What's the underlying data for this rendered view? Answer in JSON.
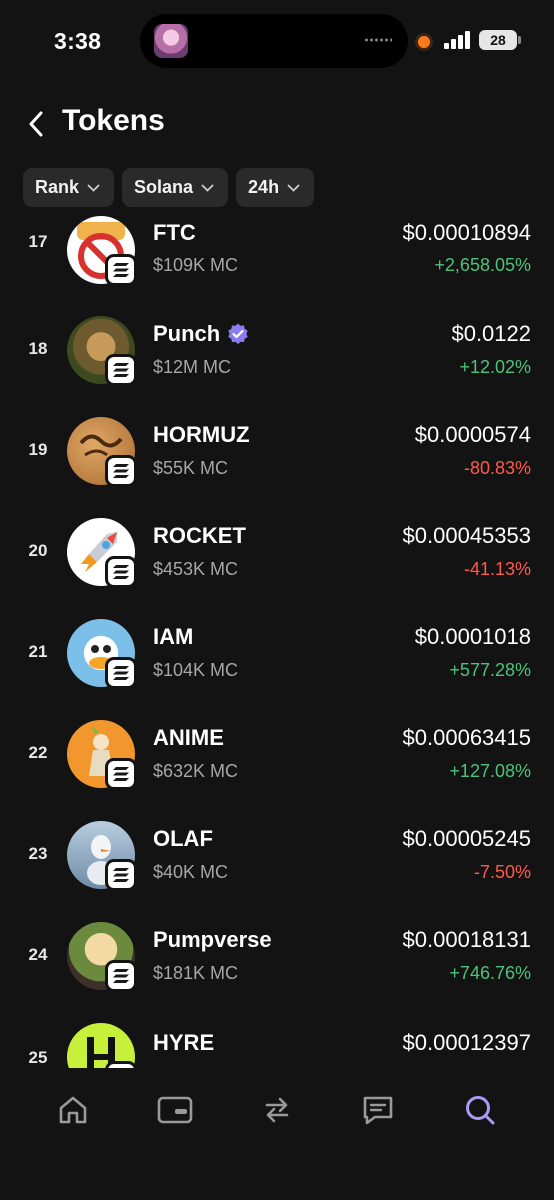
{
  "status_bar": {
    "time": "3:38",
    "battery": "28"
  },
  "header": {
    "title": "Tokens"
  },
  "filters": [
    {
      "label": "Rank"
    },
    {
      "label": "Solana"
    },
    {
      "label": "24h"
    }
  ],
  "tokens": [
    {
      "rank": "17",
      "name": "FTC",
      "market_cap": "$109K MC",
      "price": "$0.00010894",
      "change": "+2,658.05%",
      "direction": "up",
      "verified": false
    },
    {
      "rank": "18",
      "name": "Punch",
      "market_cap": "$12M MC",
      "price": "$0.0122",
      "change": "+12.02%",
      "direction": "up",
      "verified": true
    },
    {
      "rank": "19",
      "name": "HORMUZ",
      "market_cap": "$55K MC",
      "price": "$0.0000574",
      "change": "-80.83%",
      "direction": "down",
      "verified": false
    },
    {
      "rank": "20",
      "name": "ROCKET",
      "market_cap": "$453K MC",
      "price": "$0.00045353",
      "change": "-41.13%",
      "direction": "down",
      "verified": false
    },
    {
      "rank": "21",
      "name": "IAM",
      "market_cap": "$104K MC",
      "price": "$0.0001018",
      "change": "+577.28%",
      "direction": "up",
      "verified": false
    },
    {
      "rank": "22",
      "name": "ANIME",
      "market_cap": "$632K MC",
      "price": "$0.00063415",
      "change": "+127.08%",
      "direction": "up",
      "verified": false
    },
    {
      "rank": "23",
      "name": "OLAF",
      "market_cap": "$40K MC",
      "price": "$0.00005245",
      "change": "-7.50%",
      "direction": "down",
      "verified": false
    },
    {
      "rank": "24",
      "name": "Pumpverse",
      "market_cap": "$181K MC",
      "price": "$0.00018131",
      "change": "+746.76%",
      "direction": "up",
      "verified": false
    },
    {
      "rank": "25",
      "name": "HYRE",
      "market_cap": "",
      "price": "$0.00012397",
      "change": "",
      "direction": "up",
      "verified": false
    }
  ],
  "colors": {
    "up": "#4cc37a",
    "down": "#ff5a4a",
    "active_nav": "#a99cf5",
    "inactive_nav": "#9a9a9a"
  },
  "nav": [
    {
      "icon": "home-icon",
      "active": false
    },
    {
      "icon": "wallet-icon",
      "active": false
    },
    {
      "icon": "swap-icon",
      "active": false
    },
    {
      "icon": "chat-icon",
      "active": false
    },
    {
      "icon": "search-icon",
      "active": true
    }
  ]
}
